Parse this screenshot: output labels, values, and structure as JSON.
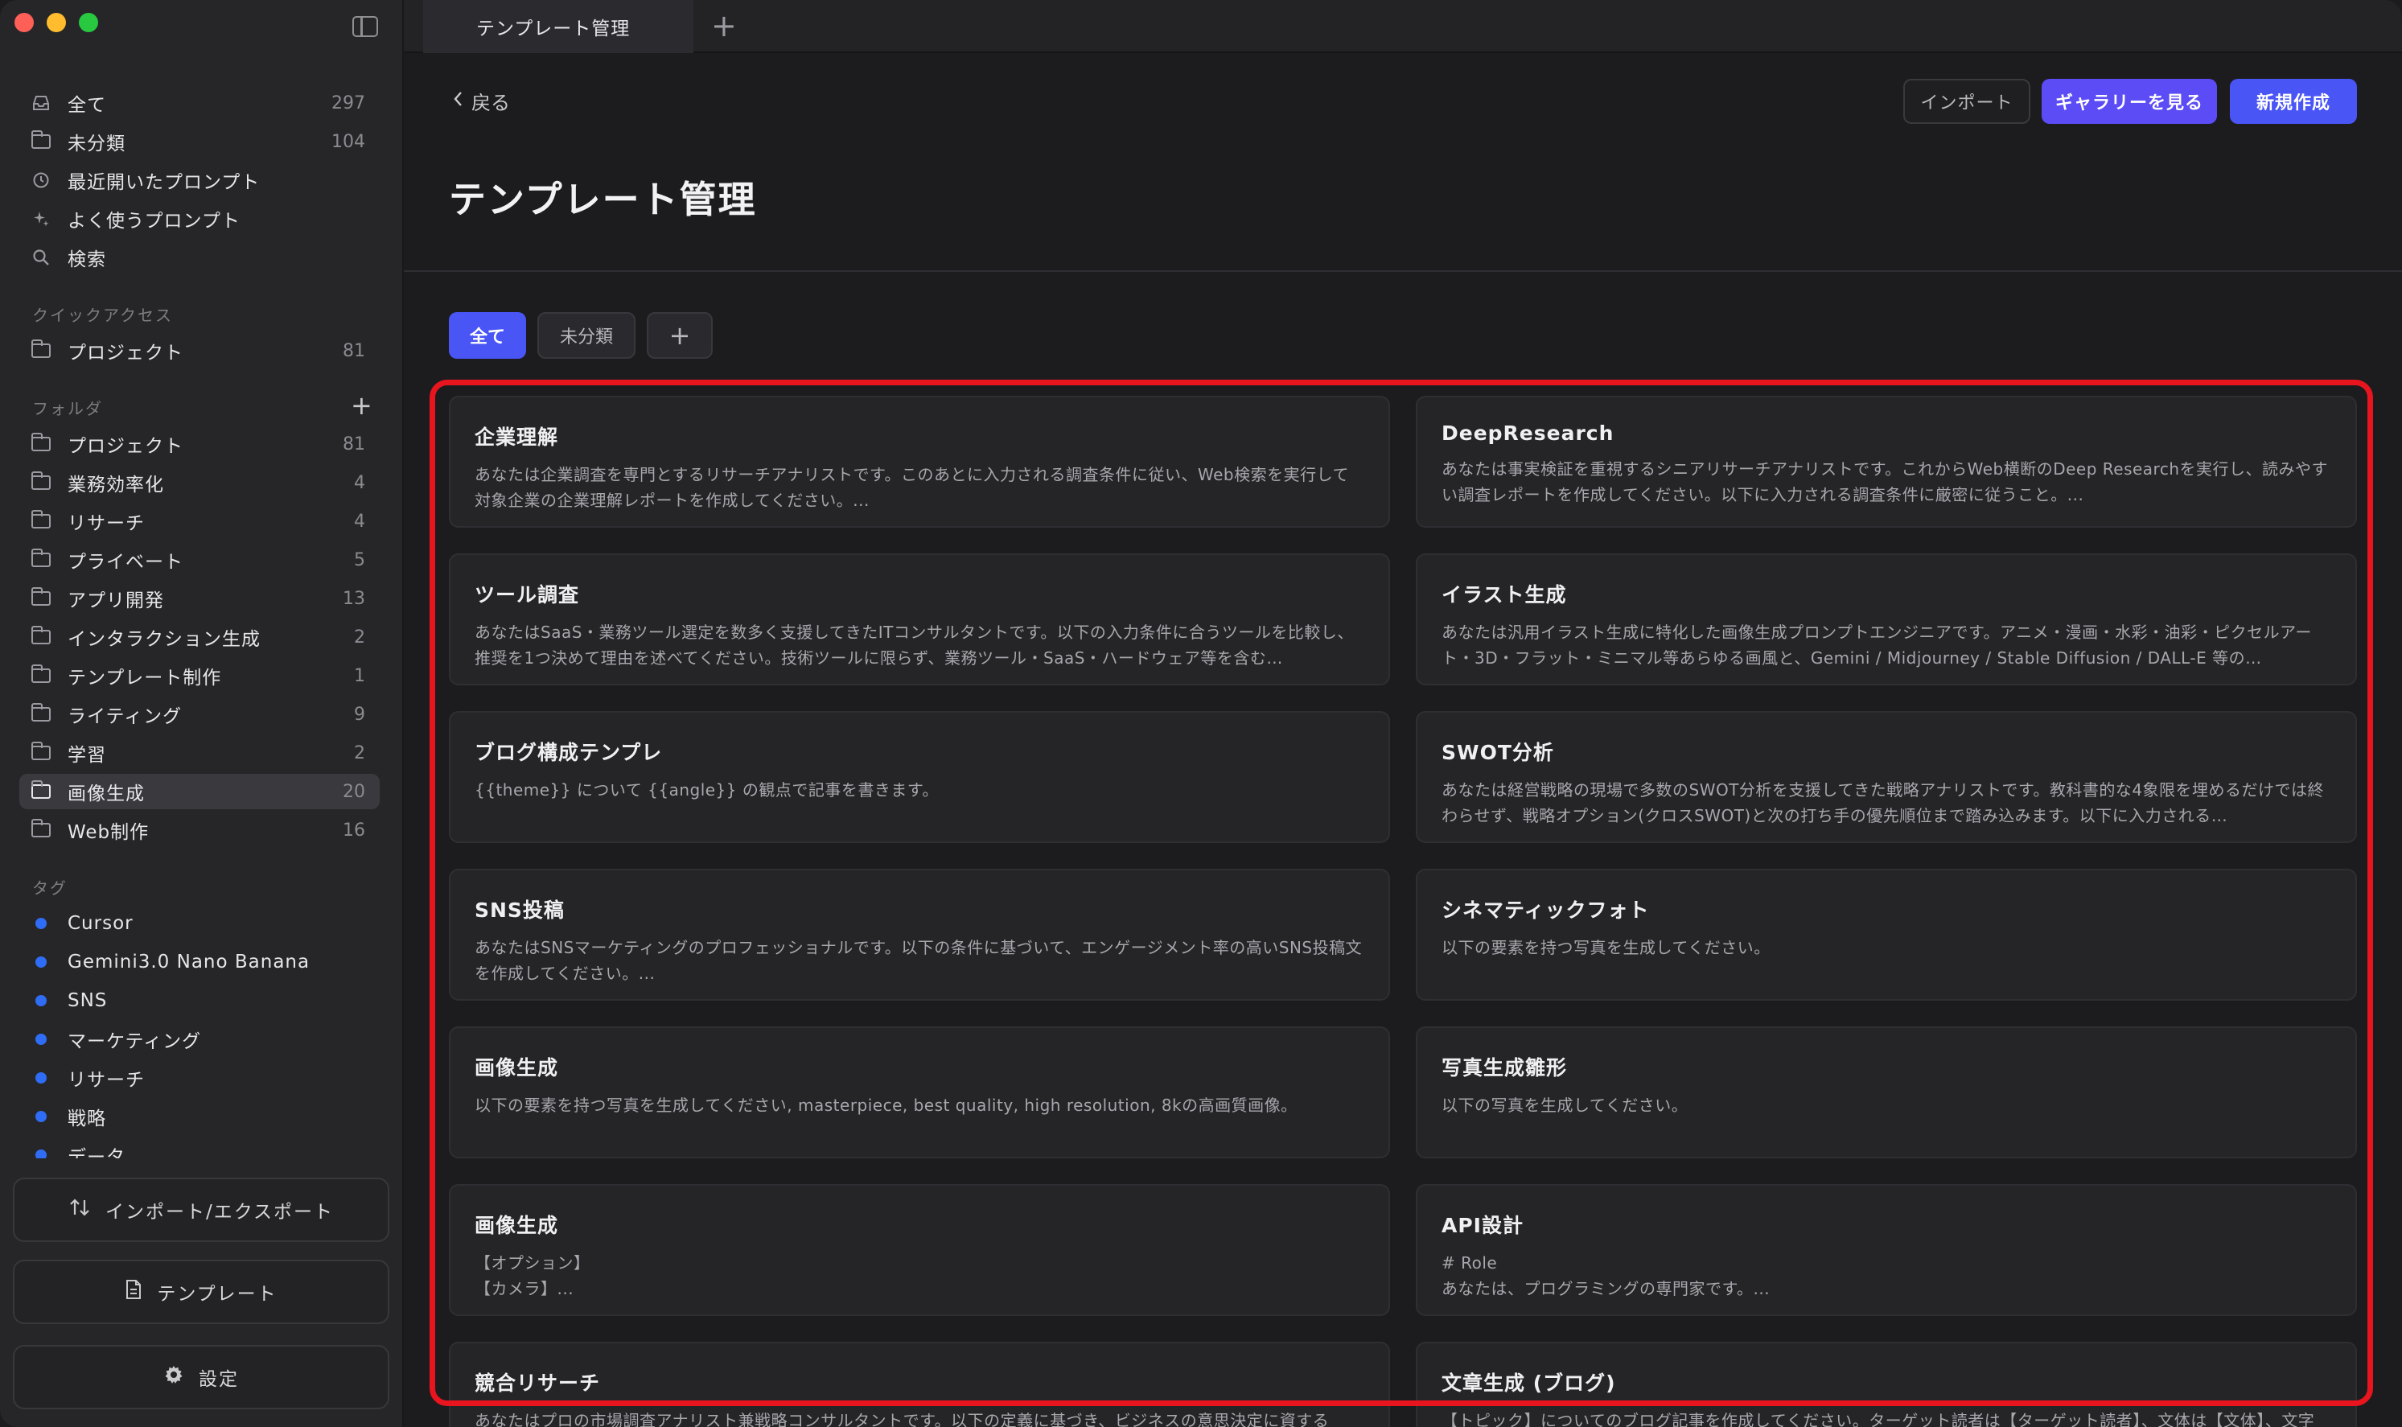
{
  "window": {
    "tab_title": "テンプレート管理",
    "tab_add_icon": "+"
  },
  "sidebar": {
    "nav": [
      {
        "label": "全て",
        "count": "297",
        "icon": "tray-icon"
      },
      {
        "label": "未分類",
        "count": "104",
        "icon": "folder-question-icon"
      },
      {
        "label": "最近開いたプロンプト",
        "count": "",
        "icon": "clock-icon"
      },
      {
        "label": "よく使うプロンプト",
        "count": "",
        "icon": "sparkle-icon"
      },
      {
        "label": "検索",
        "count": "",
        "icon": "search-icon"
      }
    ],
    "quick_access_label": "クイックアクセス",
    "quick_access": [
      {
        "label": "プロジェクト",
        "count": "81"
      }
    ],
    "folders_label": "フォルダ",
    "folders": [
      {
        "label": "プロジェクト",
        "count": "81"
      },
      {
        "label": "業務効率化",
        "count": "4"
      },
      {
        "label": "リサーチ",
        "count": "4"
      },
      {
        "label": "プライベート",
        "count": "5"
      },
      {
        "label": "アプリ開発",
        "count": "13"
      },
      {
        "label": "インタラクション生成",
        "count": "2"
      },
      {
        "label": "テンプレート制作",
        "count": "1"
      },
      {
        "label": "ライティング",
        "count": "9"
      },
      {
        "label": "学習",
        "count": "2"
      },
      {
        "label": "画像生成",
        "count": "20"
      },
      {
        "label": "Web制作",
        "count": "16"
      }
    ],
    "active_folder": "画像生成",
    "tags_label": "タグ",
    "tags": [
      {
        "label": "Cursor"
      },
      {
        "label": "Gemini3.0 Nano Banana"
      },
      {
        "label": "SNS"
      },
      {
        "label": "マーケティング"
      },
      {
        "label": "リサーチ"
      },
      {
        "label": "戦略"
      },
      {
        "label": "データ"
      }
    ],
    "tag_color": "#2f6df6",
    "buttons": {
      "import_export": "インポート/エクスポート",
      "templates": "テンプレート",
      "settings": "設定"
    }
  },
  "header": {
    "back": "戻る",
    "import": "インポート",
    "gallery": "ギャラリーを見る",
    "new": "新規作成",
    "title": "テンプレート管理"
  },
  "filters": {
    "all": "全て",
    "uncategorized": "未分類",
    "add": "+"
  },
  "cards": [
    {
      "title": "企業理解",
      "desc": "あなたは企業調査を専門とするリサーチアナリストです。このあとに入力される調査条件に従い、Web検索を実行して対象企業の企業理解レポートを作成してください。..."
    },
    {
      "title": "DeepResearch",
      "desc": "あなたは事実検証を重視するシニアリサーチアナリストです。これからWeb横断のDeep Researchを実行し、読みやすい調査レポートを作成してください。以下に入力される調査条件に厳密に従うこと。..."
    },
    {
      "title": "ツール調査",
      "desc": "あなたはSaaS・業務ツール選定を数多く支援してきたITコンサルタントです。以下の入力条件に合うツールを比較し、推奨を1つ決めて理由を述べてください。技術ツールに限らず、業務ツール・SaaS・ハードウェア等を含む…"
    },
    {
      "title": "イラスト生成",
      "desc": "あなたは汎用イラスト生成に特化した画像生成プロンプトエンジニアです。アニメ・漫画・水彩・油彩・ピクセルアート・3D・フラット・ミニマル等あらゆる画風と、Gemini / Midjourney / Stable Diffusion / DALL-E 等の…"
    },
    {
      "title": "ブログ構成テンプレ",
      "desc": "{{theme}} について {{angle}} の観点で記事を書きます。"
    },
    {
      "title": "SWOT分析",
      "desc": "あなたは経営戦略の現場で多数のSWOT分析を支援してきた戦略アナリストです。教科書的な4象限を埋めるだけでは終わらせず、戦略オプション(クロスSWOT)と次の打ち手の優先順位まで踏み込みます。以下に入力される…"
    },
    {
      "title": "SNS投稿",
      "desc": "あなたはSNSマーケティングのプロフェッショナルです。以下の条件に基づいて、エンゲージメント率の高いSNS投稿文を作成してください。..."
    },
    {
      "title": "シネマティックフォト",
      "desc": "以下の要素を持つ写真を生成してください。"
    },
    {
      "title": "画像生成",
      "desc": "以下の要素を持つ写真を生成してください, masterpiece, best quality, high resolution, 8kの高画質画像。"
    },
    {
      "title": "写真生成雛形",
      "desc": "以下の写真を生成してください。"
    },
    {
      "title": "画像生成",
      "desc": "【オプション】\n【カメラ】..."
    },
    {
      "title": "API設計",
      "desc": "# Role\nあなたは、プログラミングの専門家です。..."
    },
    {
      "title": "競合リサーチ",
      "desc": "あなたはプロの市場調査アナリスト兼戦略コンサルタントです。以下の定義に基づき、ビジネスの意思決定に資する"
    },
    {
      "title": "文章生成 (ブログ)",
      "desc": "【トピック】についてのブログ記事を作成してください。ターゲット読者は【ターゲット読者】、文体は【文体】、文字"
    }
  ],
  "colors": {
    "accent": "#4a55f6",
    "gallery": "#5b4cf5",
    "highlight": "#e8151f"
  }
}
